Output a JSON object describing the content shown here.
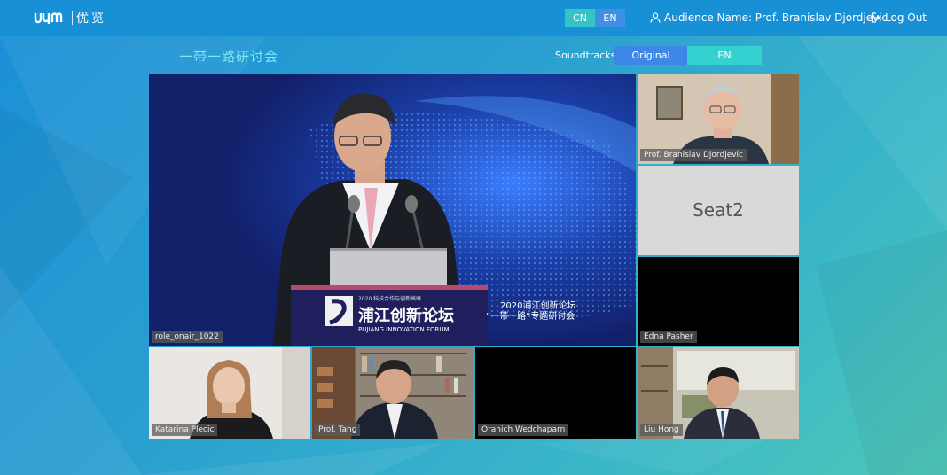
{
  "header": {
    "logo_text": "优览",
    "lang_options": [
      "CN",
      "EN"
    ],
    "lang_selected": "CN",
    "audience_label": "Audience Name: Prof. Branislav Djordjevic",
    "logout_label": "Log Out"
  },
  "meeting": {
    "title": "一带一路研讨会",
    "soundtracks_label": "Soundtracks",
    "soundtracks": [
      "Original",
      "EN"
    ],
    "soundtrack_selected": "Original"
  },
  "main_video": {
    "label": "role_onair_1022",
    "podium_line1": "2020 科技合作与创新高峰",
    "podium_title": "浦江创新论坛",
    "podium_subtitle": "PUJIANG INNOVATION FORUM",
    "stage_line1": "2020浦江创新论坛",
    "stage_line2": "“一带一路”专题研讨会"
  },
  "participants": {
    "side1": "Prof. Branislav Djordjevic",
    "side2_seat": "Seat2",
    "side3": "Edna Pasher",
    "bottom1": "Katarina Plecic",
    "bottom2": "Prof. Tang",
    "bottom3": "Oranich Wedchaparn",
    "bottom4": "Liu Hong"
  },
  "colors": {
    "topbar": "#1890d6",
    "accent_teal": "#36c3c7",
    "accent_blue": "#3d88e6",
    "title_cyan": "#7de8f2"
  }
}
